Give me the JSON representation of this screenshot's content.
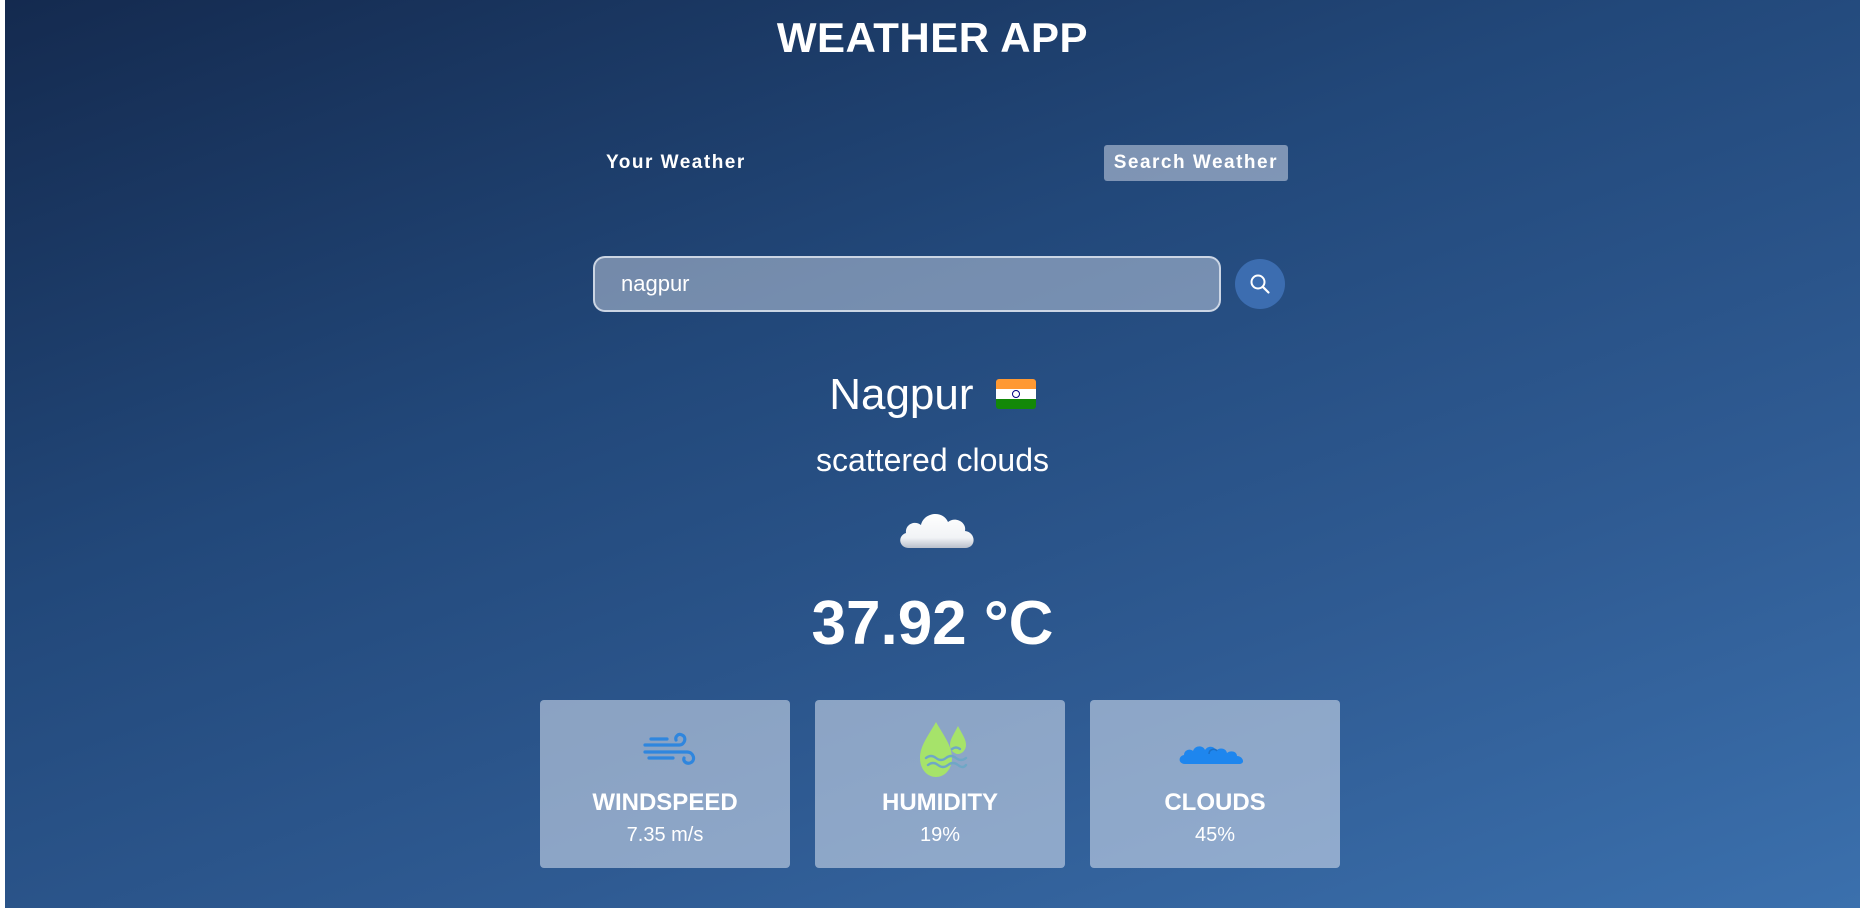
{
  "app": {
    "title": "WEATHER APP"
  },
  "tabs": [
    {
      "label": "Your Weather",
      "active": false
    },
    {
      "label": "Search Weather",
      "active": true
    }
  ],
  "search": {
    "value": "nagpur",
    "placeholder": "",
    "button_icon": "search-icon"
  },
  "weather": {
    "city": "Nagpur",
    "country_flag_icon": "india-flag-icon",
    "description": "scattered clouds",
    "condition_icon": "cloud-icon",
    "temperature": "37.92 °C"
  },
  "stats": [
    {
      "label": "WINDSPEED",
      "value": "7.35 m/s",
      "icon": "wind-icon"
    },
    {
      "label": "HUMIDITY",
      "value": "19%",
      "icon": "humidity-drops-icon"
    },
    {
      "label": "CLOUDS",
      "value": "45%",
      "icon": "clouds-icon"
    }
  ],
  "colors": {
    "background_top": "#142a4f",
    "background_bottom": "#3b70ad",
    "search_button": "#3c6db0",
    "humidity_icon": "#a6e36a",
    "wind_icon": "#2f86de",
    "clouds_icon": "#1e86ee"
  }
}
